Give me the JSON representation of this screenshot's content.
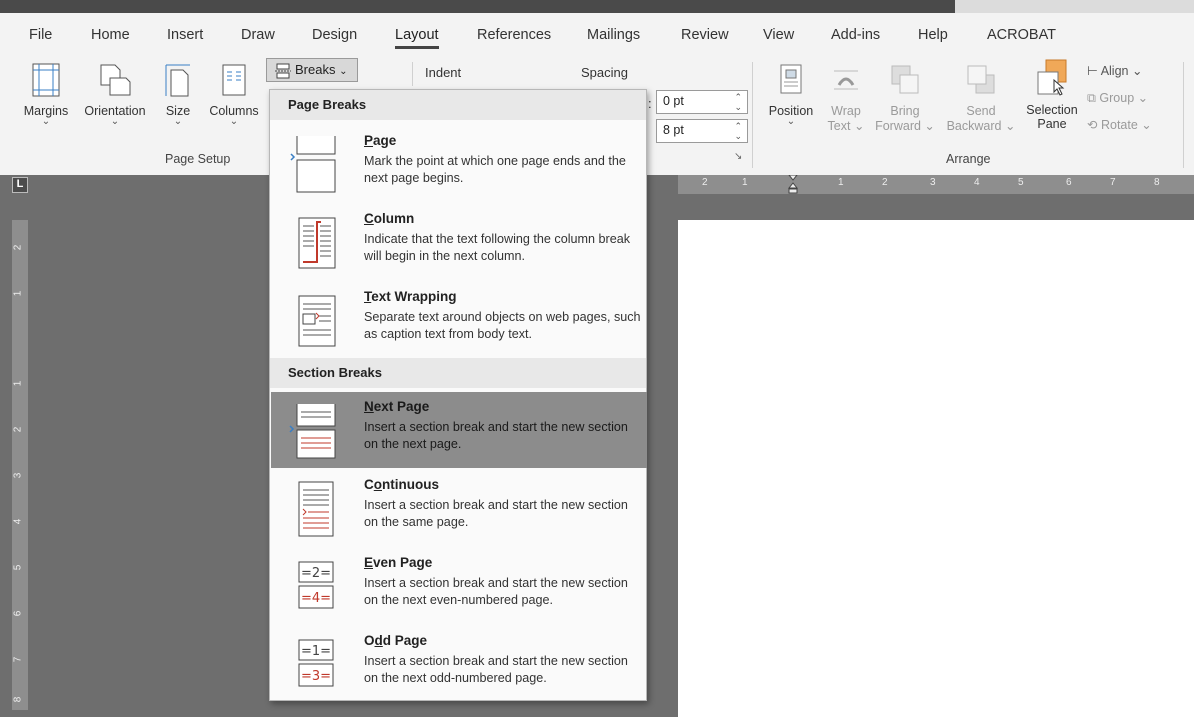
{
  "tabs": [
    "File",
    "Home",
    "Insert",
    "Draw",
    "Design",
    "Layout",
    "References",
    "Mailings",
    "Review",
    "View",
    "Add-ins",
    "Help",
    "ACROBAT"
  ],
  "page_setup": {
    "margins": "Margins",
    "orientation": "Orientation",
    "size": "Size",
    "columns": "Columns",
    "breaks": "Breaks",
    "group_label": "Page Setup"
  },
  "paragraph": {
    "indent_label": "Indent",
    "spacing_label": "Spacing",
    "spacing_before": "0 pt",
    "spacing_after": "8 pt"
  },
  "arrange": {
    "position": "Position",
    "wrap_text": [
      "Wrap",
      "Text"
    ],
    "bring_forward": [
      "Bring",
      "Forward"
    ],
    "send_backward": [
      "Send",
      "Backward"
    ],
    "selection_pane": [
      "Selection",
      "Pane"
    ],
    "align": "Align",
    "group": "Group",
    "rotate": "Rotate",
    "group_label": "Arrange"
  },
  "ruler": {
    "corner": "L",
    "h_numbers": [
      "2",
      "1",
      "1",
      "2",
      "3",
      "4",
      "5",
      "6",
      "7",
      "8"
    ],
    "v_numbers": [
      "2",
      "1",
      "1",
      "2",
      "3",
      "4",
      "5",
      "6",
      "7",
      "8"
    ]
  },
  "breaks_menu": {
    "page_breaks_header": "Page Breaks",
    "section_breaks_header": "Section Breaks",
    "items": [
      {
        "mnemonic": "P",
        "rest": "age",
        "desc": "Mark the point at which one page ends and the next page begins."
      },
      {
        "mnemonic": "C",
        "rest": "olumn",
        "desc": "Indicate that the text following the column break will begin in the next column."
      },
      {
        "mnemonic": "T",
        "rest": "ext Wrapping",
        "desc": "Separate text around objects on web pages, such as caption text from body text."
      },
      {
        "mnemonic": "N",
        "rest": "ext Page",
        "desc": "Insert a section break and start the new section on the next page."
      },
      {
        "pre": "C",
        "mnemonic": "o",
        "rest": "ntinuous",
        "desc": "Insert a section break and start the new section on the same page."
      },
      {
        "mnemonic": "E",
        "rest": "ven Page",
        "desc": "Insert a section break and start the new section on the next even-numbered page."
      },
      {
        "pre": "O",
        "mnemonic": "d",
        "rest": "d Page",
        "desc": "Insert a section break and start the new section on the next odd-numbered page."
      }
    ]
  },
  "colors": {
    "ribbon": "#f3f3f3",
    "canvas": "#6e6e6e",
    "highlight": "#8c8c8c",
    "accent_orange": "#f0a858",
    "break_red": "#c0392b"
  }
}
